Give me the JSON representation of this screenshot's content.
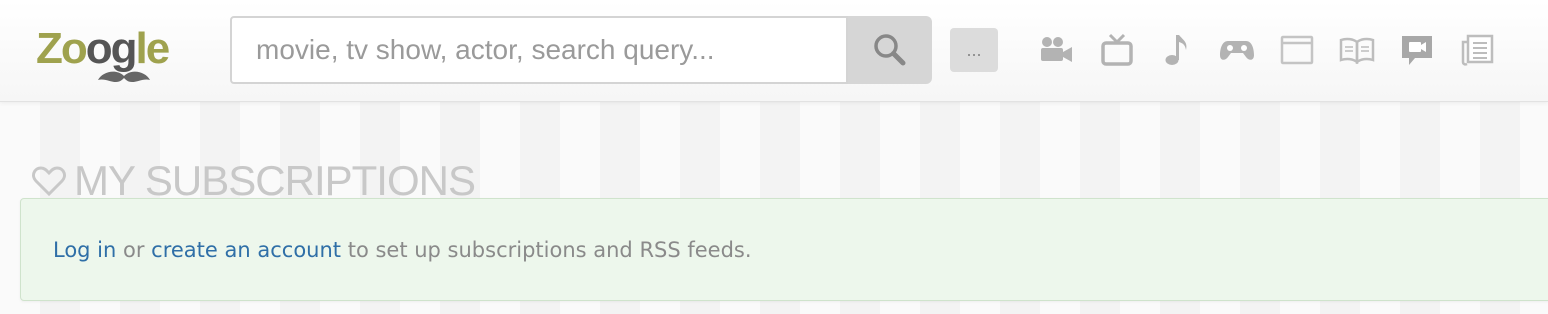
{
  "header": {
    "logo_text_start": "Zo",
    "logo_text_mid": "og",
    "logo_text_end": "le",
    "search_placeholder": "movie, tv show, actor, search query...",
    "more_label": "...",
    "categories": [
      {
        "icon": "movie-camera-icon"
      },
      {
        "icon": "tv-icon"
      },
      {
        "icon": "music-note-icon"
      },
      {
        "icon": "gamepad-icon"
      },
      {
        "icon": "browser-window-icon"
      },
      {
        "icon": "book-icon"
      },
      {
        "icon": "video-chat-icon"
      },
      {
        "icon": "news-icon"
      }
    ]
  },
  "section": {
    "title": "MY SUBSCRIPTIONS",
    "icon": "heart-outline-icon"
  },
  "notice": {
    "login_link": "Log in",
    "or_text": " or ",
    "create_link": "create an account",
    "rest_text": " to set up subscriptions and RSS feeds."
  },
  "colors": {
    "link": "#2f6fa7",
    "notice_bg": "#edf7ec",
    "logo_green": "#9fa24e"
  }
}
